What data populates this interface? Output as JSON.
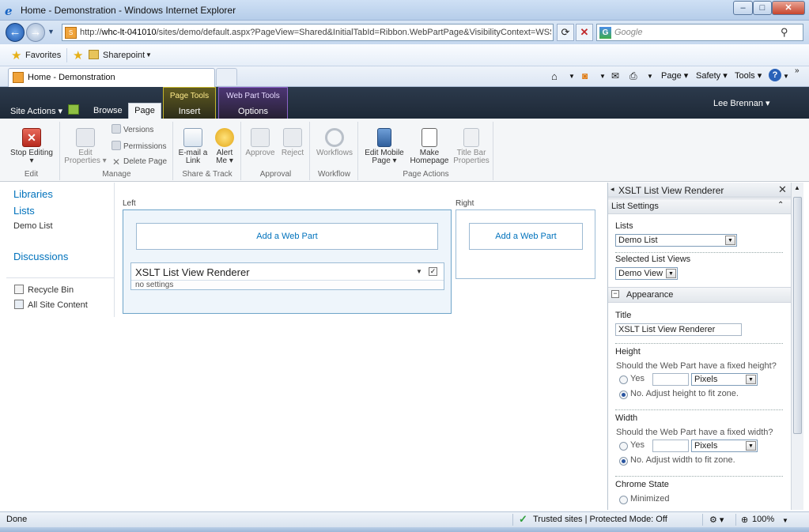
{
  "window": {
    "title": "Home - Demonstration - Windows Internet Explorer",
    "min_glyph": "–",
    "max_glyph": "□",
    "close_glyph": "✕"
  },
  "address": {
    "url_prefix": "http://",
    "url_host": "whc-lt-041010",
    "url_rest": "/sites/demo/default.aspx?PageView=Shared&InitialTabId=Ribbon.WebPartPage&VisibilityContext=WSSW",
    "search_placeholder": "Google"
  },
  "favorites": {
    "favorites_label": "Favorites",
    "sharepoint_label": "Sharepoint"
  },
  "tab": {
    "label": "Home - Demonstration"
  },
  "commandbar": {
    "page": "Page",
    "safety": "Safety",
    "tools": "Tools"
  },
  "ribbon": {
    "site_actions": "Site Actions",
    "browse": "Browse",
    "page": "Page",
    "page_tools": "Page Tools",
    "insert": "Insert",
    "web_part_tools": "Web Part Tools",
    "options": "Options",
    "user": "Lee Brennan",
    "groups": {
      "edit": "Edit",
      "manage": "Manage",
      "share_track": "Share & Track",
      "approval": "Approval",
      "workflow": "Workflow",
      "page_actions": "Page Actions"
    },
    "buttons": {
      "stop_editing": "Stop Editing",
      "edit_properties_1": "Edit",
      "edit_properties_2": "Properties",
      "versions": "Versions",
      "permissions": "Permissions",
      "delete_page": "Delete Page",
      "email_link_1": "E-mail a",
      "email_link_2": "Link",
      "alert_me_1": "Alert",
      "alert_me_2": "Me",
      "approve": "Approve",
      "reject": "Reject",
      "workflows": "Workflows",
      "edit_mobile_1": "Edit Mobile",
      "edit_mobile_2": "Page",
      "make_homepage_1": "Make",
      "make_homepage_2": "Homepage",
      "title_bar_1": "Title Bar",
      "title_bar_2": "Properties"
    }
  },
  "leftnav": {
    "libraries": "Libraries",
    "lists": "Lists",
    "demo_list": "Demo List",
    "discussions": "Discussions",
    "recycle_bin": "Recycle Bin",
    "all_site_content": "All Site Content"
  },
  "zones": {
    "left_label": "Left",
    "right_label": "Right",
    "add_web_part": "Add a Web Part",
    "webpart_title": "XSLT List View Renderer",
    "webpart_body": "no settings"
  },
  "toolpane": {
    "title": "XSLT List View Renderer",
    "list_settings": "List Settings",
    "lists_label": "Lists",
    "lists_value": "Demo List",
    "views_label": "Selected List Views",
    "views_value": "Demo View",
    "appearance": "Appearance",
    "title_label": "Title",
    "title_value": "XSLT List View Renderer",
    "height_label": "Height",
    "height_question": "Should the Web Part have a fixed height?",
    "yes": "Yes",
    "pixels": "Pixels",
    "height_no": "No. Adjust height to fit zone.",
    "width_label": "Width",
    "width_question": "Should the Web Part have a fixed width?",
    "width_no": "No. Adjust width to fit zone.",
    "chrome_state": "Chrome State",
    "minimized": "Minimized"
  },
  "status": {
    "done": "Done",
    "zone": "Trusted sites | Protected Mode: Off",
    "zoom": "100%"
  }
}
